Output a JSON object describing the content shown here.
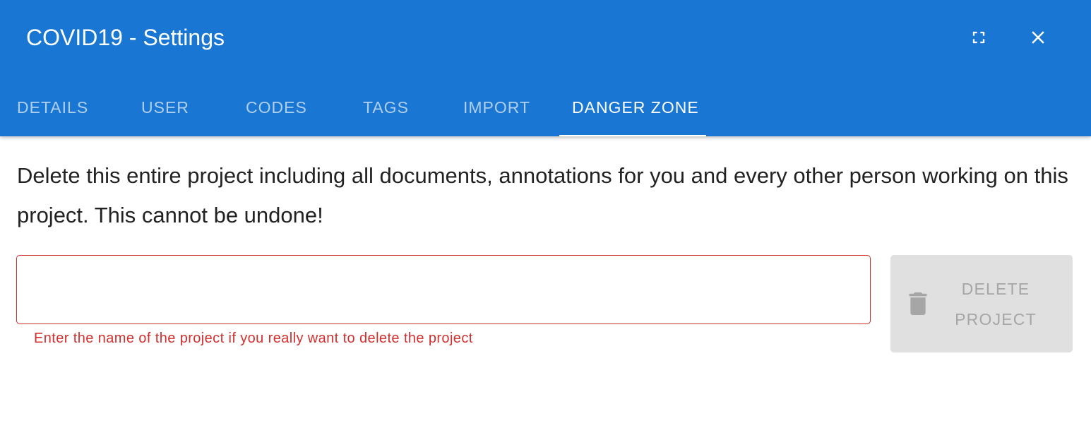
{
  "dialog": {
    "title": "COVID19 - Settings",
    "toolbar_color": "#1976d2",
    "icons": {
      "fullscreen": "fullscreen-icon",
      "close": "close-icon"
    }
  },
  "tabs": [
    {
      "label": "DETAILS",
      "active": false
    },
    {
      "label": "USER",
      "active": false
    },
    {
      "label": "CODES",
      "active": false
    },
    {
      "label": "TAGS",
      "active": false
    },
    {
      "label": "IMPORT",
      "active": false
    },
    {
      "label": "DANGER ZONE",
      "active": true
    }
  ],
  "danger_zone": {
    "warning_text": "Delete this entire project including all documents, annotations for you and every other person working on this project. This cannot be undone!",
    "project_name_input": {
      "value": "",
      "placeholder": ""
    },
    "hint_text": "Enter the name of the project if you really want to delete the project",
    "error_color": "#d32f2f",
    "delete_button": {
      "label": "DELETE PROJECT",
      "icon": "trash-icon",
      "disabled": true
    }
  }
}
